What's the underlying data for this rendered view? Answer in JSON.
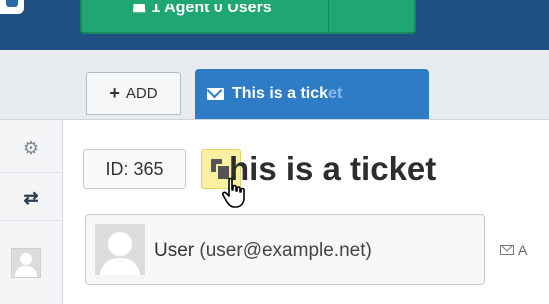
{
  "header": {
    "status_text": "1 Agent   0 Users",
    "brand_color": "#205081",
    "status_color": "#1fa672"
  },
  "tabs": {
    "add_label": "ADD",
    "active_tab_label": "This is a tick",
    "active_tab_fade": "et",
    "active_color": "#2f7cc6"
  },
  "sidebar": {
    "items": [
      {
        "icon": "gear-icon"
      },
      {
        "icon": "retweet-icon"
      },
      {
        "icon": "avatar"
      }
    ]
  },
  "ticket": {
    "id_label": "ID: 365",
    "title": "his is a ticket",
    "copy_icon": "copy-icon"
  },
  "customer": {
    "name": "User",
    "email": "(user@example.net)",
    "mail_link": "A"
  }
}
